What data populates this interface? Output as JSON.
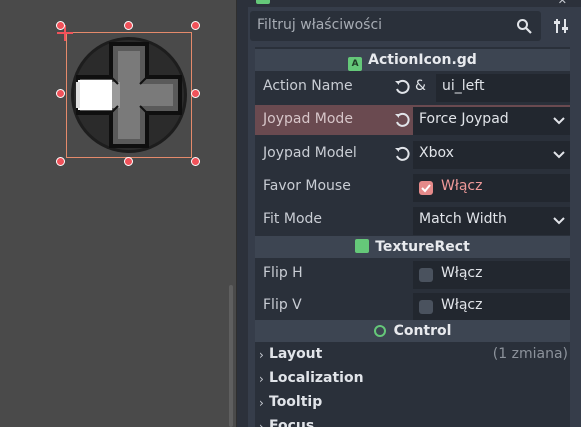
{
  "viewport": {
    "node_icon": "dpad-icon"
  },
  "filter": {
    "placeholder": "Filtruj właściwości"
  },
  "categories": {
    "script": "ActionIcon.gd",
    "texture_rect": "TextureRect",
    "control": "Control"
  },
  "props": {
    "action_name": {
      "label": "Action Name",
      "prefix": "&",
      "value": "ui_left"
    },
    "joypad_mode": {
      "label": "Joypad Mode",
      "value": "Force Joypad"
    },
    "joypad_model": {
      "label": "Joypad Model",
      "value": "Xbox"
    },
    "favor_mouse": {
      "label": "Favor Mouse",
      "check_label": "Włącz",
      "checked": true
    },
    "fit_mode": {
      "label": "Fit Mode",
      "value": "Match Width"
    },
    "flip_h": {
      "label": "Flip H",
      "check_label": "Włącz",
      "checked": false
    },
    "flip_v": {
      "label": "Flip V",
      "check_label": "Włącz",
      "checked": false
    }
  },
  "sections": [
    {
      "label": "Layout",
      "extra": "(1 zmiana)"
    },
    {
      "label": "Localization",
      "extra": ""
    },
    {
      "label": "Tooltip",
      "extra": ""
    },
    {
      "label": "Focus",
      "extra": ""
    }
  ],
  "colors": {
    "selection": "#f0525a",
    "accent_green": "#65c879",
    "checked": "#e58a8a"
  }
}
